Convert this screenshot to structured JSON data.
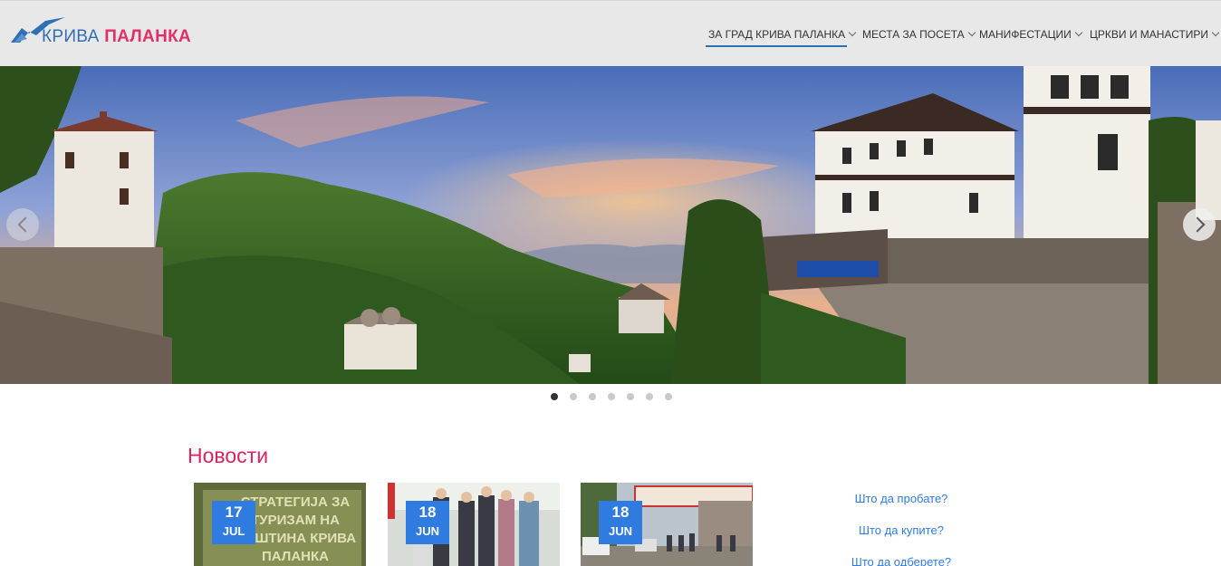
{
  "logo": {
    "word1": "КРИВА",
    "word2": "ПАЛАНКА"
  },
  "nav": {
    "items": [
      {
        "label": "ЗА ГРАД КРИВА ПАЛАНКА",
        "active": true
      },
      {
        "label": "МЕСТА ЗА ПОСЕТА",
        "active": false
      },
      {
        "label": "МАНИФЕСТАЦИИ",
        "active": false
      },
      {
        "label": "ЦРКВИ И МАНАСТИРИ",
        "active": false
      }
    ]
  },
  "slider": {
    "slide_count": 7,
    "active_index": 0
  },
  "news": {
    "title": "Новости",
    "cards": [
      {
        "day": "17",
        "month": "JUL",
        "image_text": "СТРАТЕГИЈА ЗА ТУРИЗАМ НА ОПШТИНА КРИВА ПАЛАНКА"
      },
      {
        "day": "18",
        "month": "JUN",
        "image_text": ""
      },
      {
        "day": "18",
        "month": "JUN",
        "image_text": ""
      }
    ]
  },
  "side_links": [
    {
      "label": "Што да пробате?"
    },
    {
      "label": "Што да купите?"
    },
    {
      "label": "Што да одберете?"
    }
  ],
  "colors": {
    "accent_blue": "#2f7be0",
    "brand_pink": "#d7245f",
    "header_bg": "#e8e8e8"
  }
}
